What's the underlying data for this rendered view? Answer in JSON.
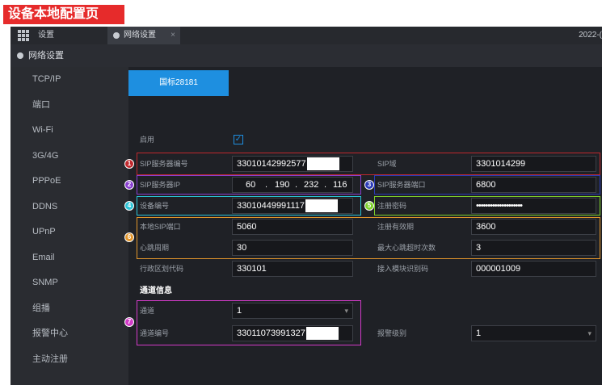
{
  "page_banner": "设备本地配置页",
  "titlebar": {
    "settings_label": "设置",
    "network_tab_label": "网络设置",
    "close_glyph": "×",
    "clock": "2022-("
  },
  "section_header": "网络设置",
  "sidebar": {
    "items": [
      {
        "label": "TCP/IP"
      },
      {
        "label": "端口"
      },
      {
        "label": "Wi-Fi"
      },
      {
        "label": "3G/4G"
      },
      {
        "label": "PPPoE"
      },
      {
        "label": "DDNS"
      },
      {
        "label": "UPnP"
      },
      {
        "label": "Email"
      },
      {
        "label": "SNMP"
      },
      {
        "label": "组播"
      },
      {
        "label": "报警中心"
      },
      {
        "label": "主动注册"
      }
    ]
  },
  "protocol_tab": "国标28181",
  "form": {
    "enable_label": "启用",
    "enable_checked": true,
    "check_glyph": "✓",
    "sip_server_id_label": "SIP服务器编号",
    "sip_server_id_value": "33010142992577",
    "sip_domain_label": "SIP域",
    "sip_domain_value": "3301014299",
    "sip_server_ip_label": "SIP服务器IP",
    "ip_octets": [
      "60",
      "190",
      "232",
      "116"
    ],
    "ip_dot": ".",
    "sip_server_port_label": "SIP服务器端口",
    "sip_server_port_value": "6800",
    "device_id_label": "设备编号",
    "device_id_value": "33010449991117",
    "register_password_label": "注册密码",
    "register_password_value": "••••••••••••••••••••",
    "local_sip_port_label": "本地SIP端口",
    "local_sip_port_value": "5060",
    "register_validity_label": "注册有效期",
    "register_validity_value": "3600",
    "heartbeat_period_label": "心跳周期",
    "heartbeat_period_value": "30",
    "max_heartbeat_timeout_label": "最大心跳超时次数",
    "max_heartbeat_timeout_value": "3",
    "admin_region_code_label": "行政区划代码",
    "admin_region_code_value": "330101",
    "access_module_id_label": "接入模块识别码",
    "access_module_id_value": "000001009",
    "channel_info_title": "通道信息",
    "channel_label": "通道",
    "channel_value": "1",
    "channel_id_label": "通道编号",
    "channel_id_value": "33011073991327",
    "alarm_level_label": "报警级别",
    "alarm_level_value": "1",
    "dropdown_glyph": "▾"
  },
  "annotations": {
    "badges": [
      "1",
      "2",
      "3",
      "4",
      "5",
      "6",
      "7"
    ],
    "colors": {
      "1": "#c0282d",
      "2": "#8a3fd1",
      "3": "#2b3bb8",
      "4": "#2bc4d6",
      "5": "#7fd12b",
      "6": "#e3962b",
      "7": "#d23bc8"
    }
  },
  "colors": {
    "banner_red": "#e62b2b",
    "accent_blue": "#1e8fe0",
    "app_background": "#1f2126"
  }
}
